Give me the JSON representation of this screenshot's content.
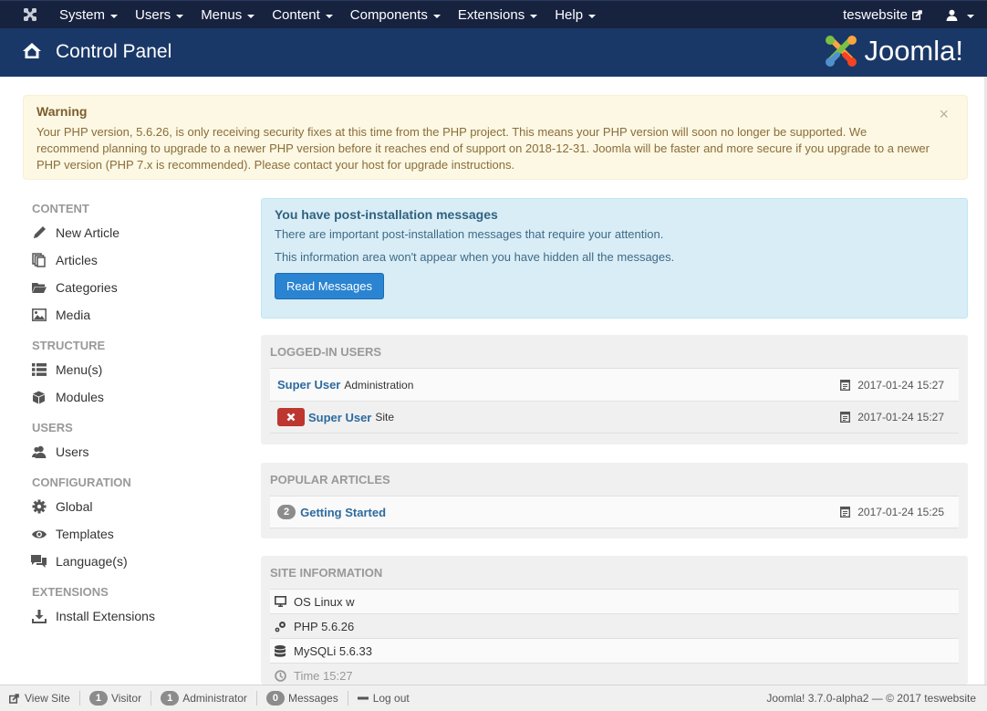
{
  "navbar": {
    "logo_icon": "joomla-icon",
    "menus": [
      {
        "label": "System"
      },
      {
        "label": "Users"
      },
      {
        "label": "Menus"
      },
      {
        "label": "Content"
      },
      {
        "label": "Components"
      },
      {
        "label": "Extensions"
      },
      {
        "label": "Help"
      }
    ],
    "site_link": "teswebsite",
    "site_link_icon": "external-link-icon",
    "user_icon": "user-icon"
  },
  "header": {
    "title": "Control Panel",
    "icon": "home-icon",
    "brand": "Joomla!"
  },
  "warning": {
    "title": "Warning",
    "message": "Your PHP version, 5.6.26, is only receiving security fixes at this time from the PHP project. This means your PHP version will soon no longer be supported. We recommend planning to upgrade to a newer PHP version before it reaches end of support on 2018-12-31. Joomla will be faster and more secure if you upgrade to a newer PHP version (PHP 7.x is recommended). Please contact your host for upgrade instructions.",
    "close_label": "×"
  },
  "sidebar": {
    "sections": [
      {
        "title": "CONTENT",
        "items": [
          {
            "label": "New Article",
            "icon": "pencil-icon"
          },
          {
            "label": "Articles",
            "icon": "stack-icon"
          },
          {
            "label": "Categories",
            "icon": "folder-icon"
          },
          {
            "label": "Media",
            "icon": "image-icon"
          }
        ]
      },
      {
        "title": "STRUCTURE",
        "items": [
          {
            "label": "Menu(s)",
            "icon": "list-icon"
          },
          {
            "label": "Modules",
            "icon": "cube-icon"
          }
        ]
      },
      {
        "title": "USERS",
        "items": [
          {
            "label": "Users",
            "icon": "users-icon"
          }
        ]
      },
      {
        "title": "CONFIGURATION",
        "items": [
          {
            "label": "Global",
            "icon": "cog-icon"
          },
          {
            "label": "Templates",
            "icon": "eye-icon"
          },
          {
            "label": "Language(s)",
            "icon": "comments-icon"
          }
        ]
      },
      {
        "title": "EXTENSIONS",
        "items": [
          {
            "label": "Install Extensions",
            "icon": "download-icon"
          }
        ]
      }
    ]
  },
  "postinstall": {
    "title": "You have post-installation messages",
    "line1": "There are important post-installation messages that require your attention.",
    "line2": "This information area won't appear when you have hidden all the messages.",
    "button": "Read Messages"
  },
  "logged_in": {
    "title": "LOGGED-IN USERS",
    "rows": [
      {
        "name": "Super User",
        "area": "Administration",
        "date": "2017-01-24 15:27",
        "logout_button": false
      },
      {
        "name": "Super User",
        "area": "Site",
        "date": "2017-01-24 15:27",
        "logout_button": true
      }
    ]
  },
  "popular": {
    "title": "POPULAR ARTICLES",
    "rows": [
      {
        "hits": "2",
        "title": "Getting Started",
        "date": "2017-01-24 15:25"
      }
    ]
  },
  "site_info": {
    "title": "SITE INFORMATION",
    "rows": [
      {
        "icon": "screen-icon",
        "text": "OS Linux w"
      },
      {
        "icon": "cogs-icon",
        "text": "PHP 5.6.26"
      },
      {
        "icon": "database-icon",
        "text": "MySQLi 5.6.33"
      },
      {
        "icon": "clock-icon",
        "text": "Time 15:27"
      }
    ]
  },
  "statusbar": {
    "view_site": "View Site",
    "visitor_count": "1",
    "visitor_label": "Visitor",
    "admin_count": "1",
    "admin_label": "Administrator",
    "messages_count": "0",
    "messages_label": "Messages",
    "logout": "Log out",
    "version": "Joomla! 3.7.0-alpha2  —  © 2017 teswebsite"
  },
  "colors": {
    "navbar": "#17223f",
    "header": "#1a3867",
    "primary_button": "#2a84d1",
    "danger_button": "#bd362f",
    "link": "#2d6a9f"
  }
}
